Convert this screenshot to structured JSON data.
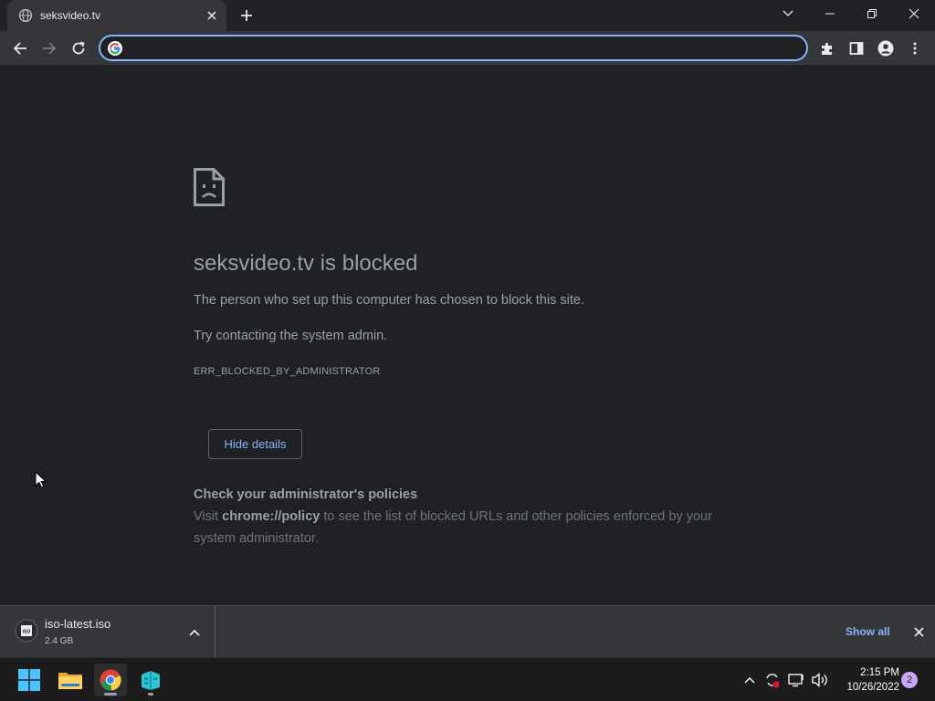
{
  "tab": {
    "title": "seksvideo.tv"
  },
  "omnibox": {
    "value": "",
    "placeholder": ""
  },
  "error": {
    "title": "seksvideo.tv is blocked",
    "line1": "The person who set up this computer has chosen to block this site.",
    "line2": "Try contacting the system admin.",
    "code": "ERR_BLOCKED_BY_ADMINISTRATOR",
    "details_button": "Hide details",
    "policy_heading": "Check your administrator's policies",
    "policy_prefix": "Visit ",
    "policy_link": "chrome://policy",
    "policy_suffix": " to see the list of blocked URLs and other policies enforced by your system administrator."
  },
  "download": {
    "filename": "iso-latest.iso",
    "size": "2.4 GB",
    "icon_label": "ISO",
    "show_all": "Show all"
  },
  "taskbar": {
    "time": "2:15 PM",
    "date": "10/26/2022",
    "notifications": "2"
  },
  "colors": {
    "accent": "#8ab4f8",
    "background": "#202124",
    "toolbar": "#35363a"
  },
  "icons": [
    "globe-icon",
    "close-icon",
    "plus-icon",
    "back-icon",
    "forward-icon",
    "reload-icon",
    "google-icon",
    "extensions-icon",
    "side-panel-icon",
    "profile-icon",
    "menu-icon",
    "sad-page-icon",
    "iso-file-icon",
    "chevron-up-icon",
    "windows-start-icon",
    "file-explorer-icon",
    "chrome-icon",
    "app-icon",
    "wifi-icon",
    "volume-icon"
  ]
}
